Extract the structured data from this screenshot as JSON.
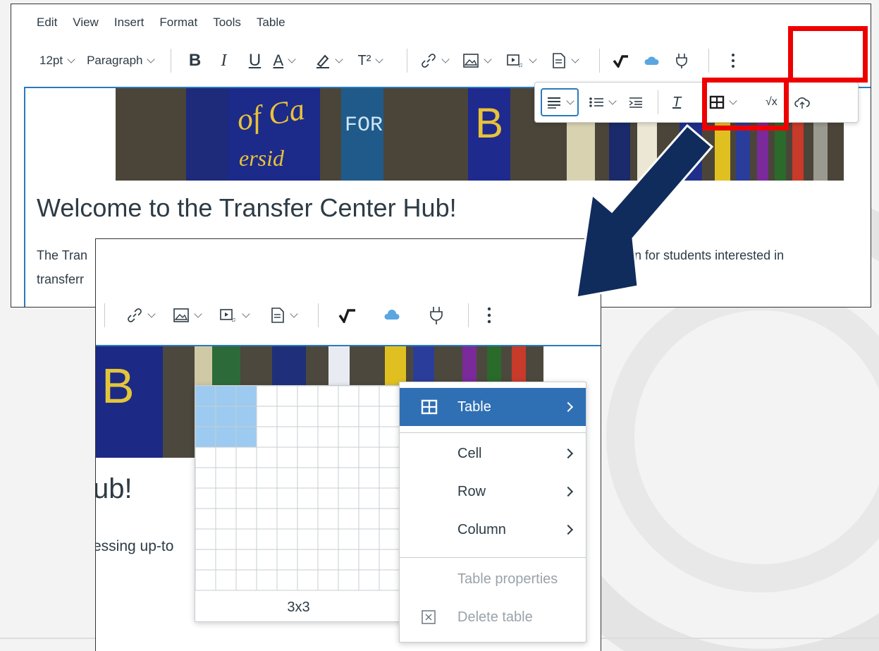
{
  "menubar": [
    "Edit",
    "View",
    "Insert",
    "Format",
    "Tools",
    "Table"
  ],
  "toolbar": {
    "font_size": "12pt",
    "block_format": "Paragraph",
    "bold": "B",
    "italic": "I",
    "underline": "U",
    "text_color": "A",
    "superscript": "T²",
    "more_icon": "more-vertical-icon"
  },
  "floating_toolbar": {
    "icons": [
      "align-icon",
      "list-icon",
      "indent-icon",
      "clear-format-icon",
      "table-icon",
      "equation-icon",
      "cloud-icon"
    ],
    "equation_label": "√x"
  },
  "content": {
    "heading": "Welcome to the Transfer Center Hub!",
    "paragraph_start_1": "The Tran",
    "paragraph_end_1": "ation for students interested in",
    "paragraph_start_2": "transferr"
  },
  "zoom": {
    "heading_fragment": "ub!",
    "paragraph_fragment": "essing up-to",
    "grid_label": "3x3",
    "grid_selected_rows": 3,
    "grid_selected_cols": 3
  },
  "table_menu": {
    "items": [
      {
        "label": "Table",
        "icon": "table-icon",
        "submenu": true,
        "active": true,
        "disabled": false
      },
      {
        "label": "Cell",
        "submenu": true,
        "disabled": false
      },
      {
        "label": "Row",
        "submenu": true,
        "disabled": false
      },
      {
        "label": "Column",
        "submenu": true,
        "disabled": false
      },
      {
        "label": "Table properties",
        "submenu": false,
        "disabled": true
      },
      {
        "label": "Delete table",
        "icon": "delete-icon",
        "submenu": false,
        "disabled": true
      }
    ]
  },
  "colors": {
    "accent_blue": "#2b7abc",
    "menu_active": "#2f6fb4",
    "highlight_red": "#ee0000",
    "arrow_navy": "#0f2c5c",
    "grid_selected": "#9ccaf0"
  }
}
